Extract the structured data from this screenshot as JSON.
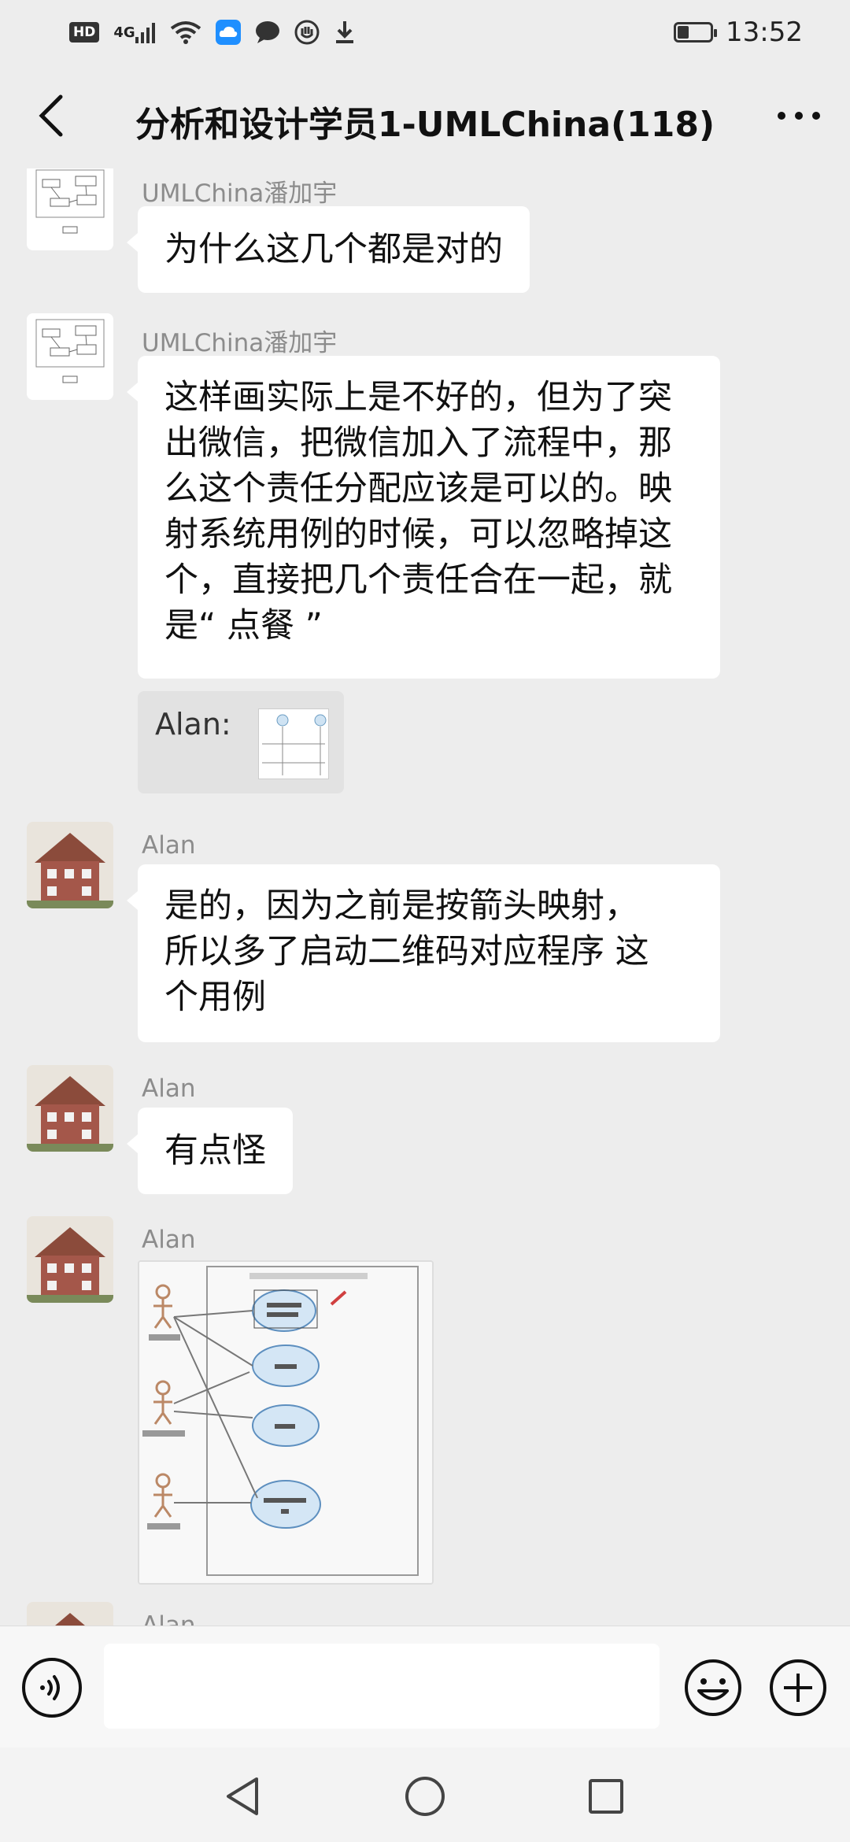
{
  "status_bar": {
    "time": "13:52",
    "network": "4G",
    "hd": "HD",
    "battery_level": 0.35,
    "icons": [
      "hd-icon",
      "signal-icon",
      "wifi-icon",
      "cloud-app-icon",
      "message-icon",
      "shield-app-icon",
      "download-icon",
      "battery-icon"
    ]
  },
  "header": {
    "title": "分析和设计学员1-UMLChina(118)",
    "back_icon": "chevron-left-icon",
    "more_icon": "more-dots-icon"
  },
  "messages": [
    {
      "sender": "UMLChina潘加宇",
      "lines": [
        "为什么这几个都是对的"
      ],
      "avatar": "diagram-thumbnail"
    },
    {
      "sender": "UMLChina潘加宇",
      "lines": [
        "这样画实际上是不好的，但为了突",
        "出微信，把微信加入了流程中，那",
        "么这个责任分配应该是可以的。映",
        "射系统用例的时候，可以忽略掉这",
        "个，直接把几个责任合在一起，就",
        "是“ 点餐 ”"
      ],
      "avatar": "diagram-thumbnail",
      "quote": {
        "text": "Alan:",
        "thumbnail": "diagram-thumbnail"
      }
    },
    {
      "sender": "Alan",
      "lines": [
        "是的，因为之前是按箭头映射，",
        "所以多了启动二维码对应程序 这",
        "个用例"
      ],
      "avatar": "house-photo"
    },
    {
      "sender": "Alan",
      "lines": [
        "有点怪"
      ],
      "avatar": "house-photo"
    },
    {
      "sender": "Alan",
      "image": "use-case-diagram",
      "avatar": "house-photo"
    },
    {
      "sender": "Alan",
      "avatar": "house-photo"
    }
  ],
  "input": {
    "placeholder": "",
    "value": ""
  },
  "input_icons": [
    "voice-icon",
    "emoji-icon",
    "plus-icon"
  ],
  "system_nav_icons": [
    "back-triangle-icon",
    "home-circle-icon",
    "recents-square-icon"
  ]
}
